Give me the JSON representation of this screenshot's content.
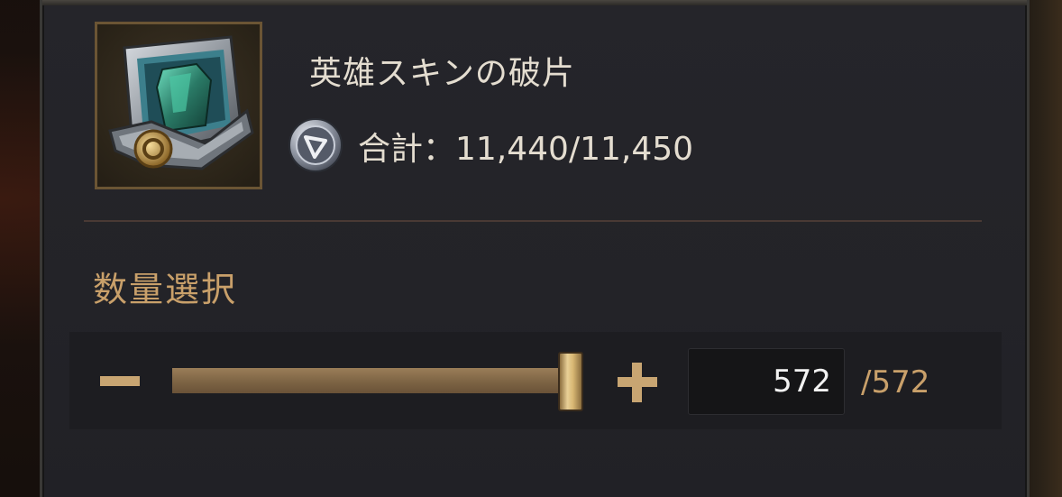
{
  "item": {
    "name": "英雄スキンの破片",
    "total_text": "合計：11,440/11,450",
    "icon": "armor-shard-icon",
    "currency_icon": "silver-coin-icon"
  },
  "quantity": {
    "section_label": "数量選択",
    "value": "572",
    "max_text": "/572",
    "slider_fraction": 1.0,
    "minus_icon": "minus-icon",
    "plus_icon": "plus-icon"
  },
  "colors": {
    "accent_gold": "#c9a06a",
    "panel_bg": "#232328",
    "text_primary": "#e4ddd0"
  }
}
